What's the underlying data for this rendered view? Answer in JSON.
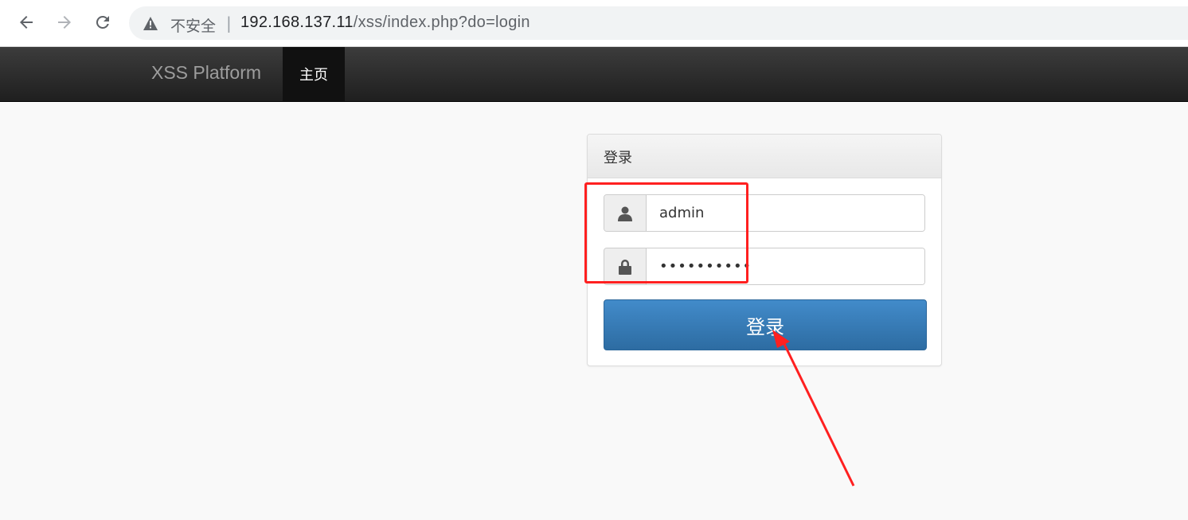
{
  "browser": {
    "security_label": "不安全",
    "separator": "|",
    "url_host": "192.168.137.11",
    "url_path": "/xss/index.php?do=login",
    "back_icon": "arrow-left-icon",
    "forward_icon": "arrow-right-icon",
    "reload_icon": "reload-icon",
    "security_icon": "warning-triangle-icon"
  },
  "navbar": {
    "brand": "XSS Platform",
    "home_label": "主页"
  },
  "login": {
    "title": "登录",
    "username_icon": "user-icon",
    "username_value": "admin",
    "password_icon": "lock-icon",
    "password_value": "••••••••••",
    "submit_label": "登录"
  },
  "colors": {
    "navbar_bg": "#222222",
    "primary_button": "#337ab7",
    "annotation": "#ff2020"
  }
}
